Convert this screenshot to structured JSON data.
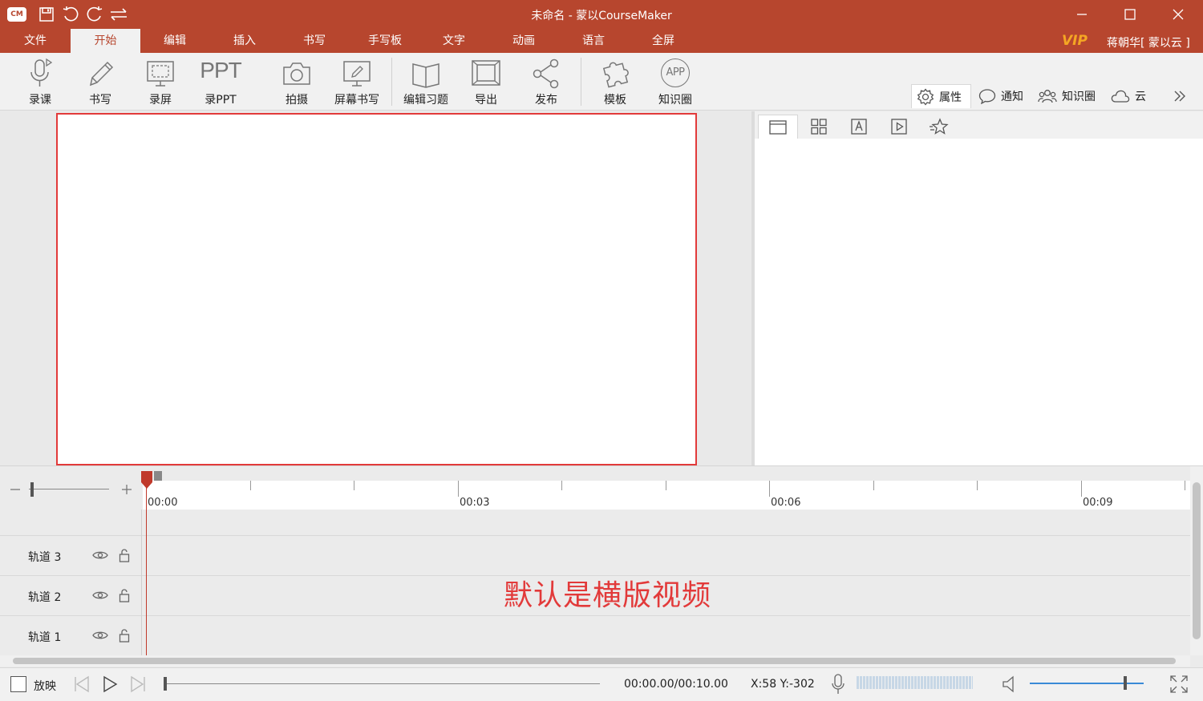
{
  "titlebar": {
    "logo": "CM",
    "title": "未命名 - 蒙以CourseMaker",
    "icons": [
      "save-icon",
      "undo-icon",
      "redo-icon",
      "swap-icon",
      "minimize-icon",
      "maximize-icon",
      "close-icon"
    ]
  },
  "menu": {
    "items": [
      "文件",
      "开始",
      "编辑",
      "插入",
      "书写",
      "手写板",
      "文字",
      "动画",
      "语言",
      "全屏"
    ],
    "active": "开始",
    "vip": "VIP",
    "user": "蒋朝华[ 蒙以云 ]"
  },
  "ribbon": {
    "tools": [
      "录课",
      "书写",
      "录屏",
      "录PPT",
      "拍摄",
      "屏幕书写",
      "编辑习题",
      "导出",
      "发布",
      "模板",
      "知识圈"
    ],
    "ppt_text": "PPT",
    "app_text": "APP",
    "right_tabs": [
      "属性",
      "通知",
      "知识圈",
      "云"
    ],
    "active_tab": "属性"
  },
  "panel": {
    "tab_icons": [
      "page-icon",
      "grid-icon",
      "text-icon",
      "media-icon",
      "star-icon"
    ]
  },
  "timeline": {
    "time_labels": [
      "00:00",
      "00:03",
      "00:06",
      "00:09"
    ],
    "tracks": [
      "轨道 3",
      "轨道 2",
      "轨道 1"
    ],
    "annotation": "默认是横版视频"
  },
  "statusbar": {
    "play_label": "放映",
    "time": "00:00.00/00:10.00",
    "coords": "X:58 Y:-302"
  },
  "colors": {
    "brand": "#b7462e",
    "vip": "#f5a623",
    "annotation": "#e23a3a"
  }
}
